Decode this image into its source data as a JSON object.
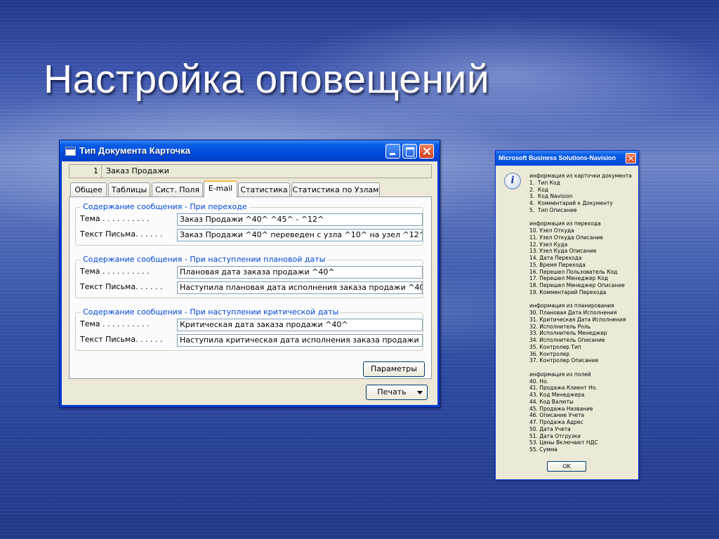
{
  "slide": {
    "title": "Настройка оповещений"
  },
  "window": {
    "title": "Тип Документа Карточка",
    "record": {
      "number": "1",
      "name": "Заказ Продажи"
    },
    "tabs": [
      "Общее",
      "Таблицы",
      "Сист. Поля",
      "E-mail",
      "Статистика",
      "Статистика по Узлам"
    ],
    "active_tab": "E-mail",
    "groups": [
      {
        "legend": "Содержание сообщения - При переходе",
        "subject_label": "Тема . . . . . . . . . .",
        "subject_value": "Заказ Продажи ^40^ ^45^ - ^12^",
        "body_label": "Текст Письма. . . . . .",
        "body_value": "Заказ Продажи ^40^ переведен с узла ^10^ на узел ^12^ ..."
      },
      {
        "legend": "Содержание сообщения - При наступлении плановой даты",
        "subject_label": "Тема . . . . . . . . . .",
        "subject_value": "Плановая дата заказа продажи ^40^",
        "body_label": "Текст Письма. . . . . .",
        "body_value": "Наступила плановая дата исполнения заказа продажи ^40..."
      },
      {
        "legend": "Содержание сообщения - При наступлении критической даты",
        "subject_label": "Тема . . . . . . . . . .",
        "subject_value": "Критическая дата заказа продажи ^40^",
        "body_label": "Текст Письма. . . . . .",
        "body_value": "Наступила критическая дата исполнения заказа продажи ^..."
      }
    ],
    "params_button": "Параметры",
    "print_button": "Печать"
  },
  "message_box": {
    "title": "Microsoft Business Solutions-Navision",
    "lines": [
      "информация из карточки документа",
      "1.  Тип Код",
      "2.  Код",
      "3.  Код Navision",
      "4.  Комментарий к Документу",
      "5.  Тип Описание",
      "",
      "информация из перехода",
      "10. Узел Откуда",
      "11. Узел Откуда Описание",
      "12. Узел Куда",
      "13. Узел Куда Описание",
      "14. Дата Перехода",
      "15. Время Перехода",
      "16. Перешел Пользователь Код",
      "17. Перешел Менеджер Код",
      "18. Перешел Менеджер Описание",
      "19. Комментарий Перехода",
      "",
      "информация из планирования",
      "30. Плановая Дата Исполнения",
      "31. Критическая Дата Исполнения",
      "32. Исполнитель Роль",
      "33. Исполнитель Менеджер",
      "34. Исполнитель Описание",
      "35. Контролер Тип",
      "36. Контролер",
      "37. Контролер Описание",
      "",
      "информация из полей",
      "40. Но.",
      "41. Продажа Клиент Но.",
      "43. Код Менеджера",
      "44. Код Валюты",
      "45. Продажа Название",
      "46. Описание Учета",
      "47. Продажа Адрес",
      "50. Дата Учета",
      "51. Дата Отгрузки",
      "53. Цены Включают НДС",
      "55. Сумма"
    ],
    "ok_button": "OK"
  }
}
